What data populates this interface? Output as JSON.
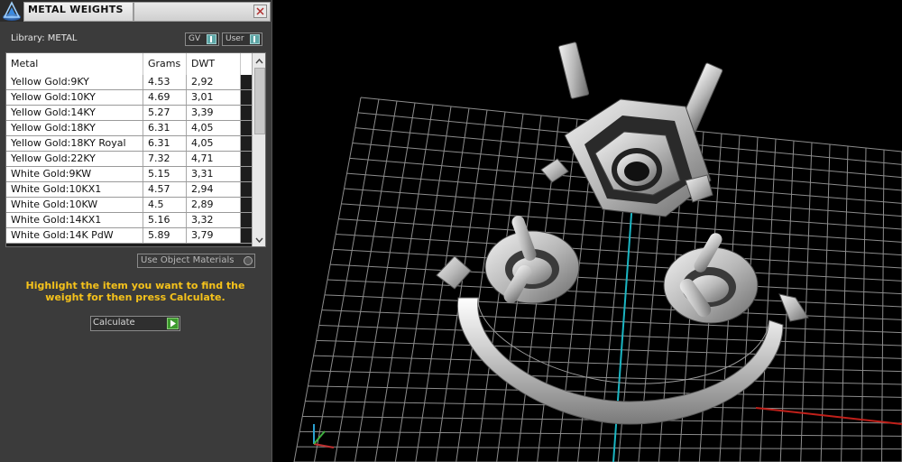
{
  "panel": {
    "title": "METAL WEIGHTS",
    "library_label": "Library: METAL",
    "toggles": {
      "gv": "GV",
      "user": "User"
    },
    "table": {
      "columns": [
        "Metal",
        "Grams",
        "DWT"
      ],
      "rows": [
        {
          "metal": "Yellow Gold:9KY",
          "grams": "4.53",
          "dwt": "2,92"
        },
        {
          "metal": "Yellow Gold:10KY",
          "grams": "4.69",
          "dwt": "3,01"
        },
        {
          "metal": "Yellow Gold:14KY",
          "grams": "5.27",
          "dwt": "3,39"
        },
        {
          "metal": "Yellow Gold:18KY",
          "grams": "6.31",
          "dwt": "4,05"
        },
        {
          "metal": "Yellow Gold:18KY Royal",
          "grams": "6.31",
          "dwt": "4,05"
        },
        {
          "metal": "Yellow Gold:22KY",
          "grams": "7.32",
          "dwt": "4,71"
        },
        {
          "metal": "White Gold:9KW",
          "grams": "5.15",
          "dwt": "3,31"
        },
        {
          "metal": "White Gold:10KX1",
          "grams": "4.57",
          "dwt": "2,94"
        },
        {
          "metal": "White Gold:10KW",
          "grams": "4.5",
          "dwt": "2,89"
        },
        {
          "metal": "White Gold:14KX1",
          "grams": "5.16",
          "dwt": "3,32"
        },
        {
          "metal": "White Gold:14K PdW",
          "grams": "5.89",
          "dwt": "3,79"
        }
      ]
    },
    "use_object_materials": "Use Object Materials",
    "hint": "Highlight the item you want to find the weight for then press Calculate.",
    "calculate_label": "Calculate"
  },
  "colors": {
    "panel_bg": "#3b3b3b",
    "hint_text": "#f5c21b",
    "toggle_accent": "#5da6a6",
    "calculate_arrow": "#3d9a2e",
    "grid_line": "#9a9a9a",
    "axis_y": "#1bb5c2",
    "axis_x": "#c0201a"
  }
}
